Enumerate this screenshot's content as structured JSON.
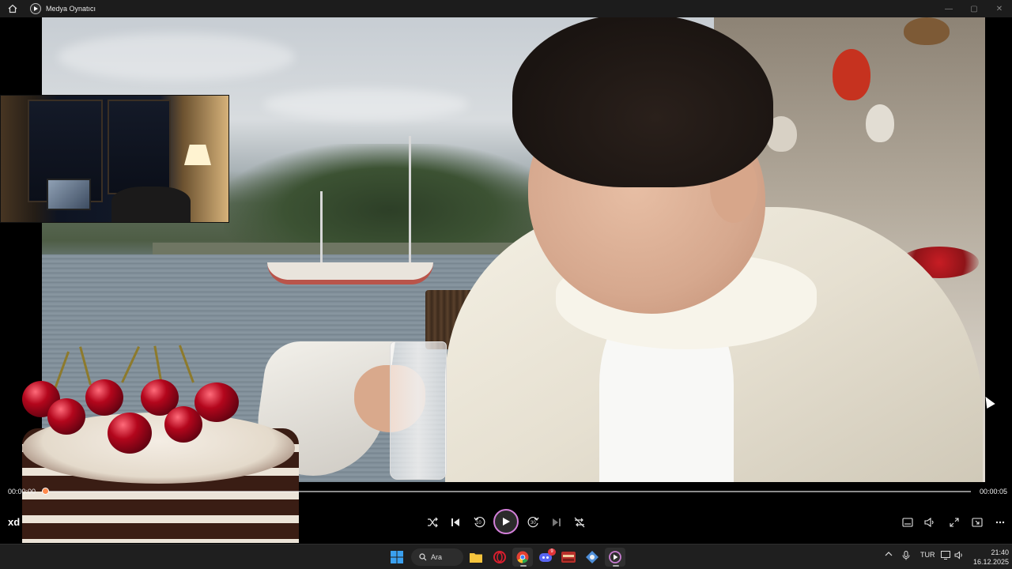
{
  "window": {
    "title": "Medya Oynatıcı",
    "home_icon": "home-icon",
    "app_icon": "media-player-icon",
    "controls": [
      "minimize-icon",
      "maximize-icon",
      "close-icon"
    ]
  },
  "player": {
    "current_time": "00:00:00",
    "total_time": "00:00:05",
    "progress_fraction": 0.0,
    "subtitle_label": "xd",
    "skip_back_seconds": "10",
    "skip_forward_seconds": "30",
    "controls": {
      "shuffle": "shuffle-icon",
      "previous": "previous-icon",
      "skip_back": "rewind-10-icon",
      "play": "play-icon",
      "skip_forward": "forward-30-icon",
      "next": "next-icon",
      "repeat_off": "repeat-off-icon",
      "captions": "captions-icon",
      "volume": "volume-icon",
      "fullscreen": "fullscreen-icon",
      "mini_player": "mini-player-icon",
      "more": "more-icon"
    },
    "accent_color": "#d27fd8",
    "seek_color": "#ff8a4c"
  },
  "taskbar": {
    "search_label": "Ara",
    "apps": [
      {
        "name": "start",
        "icon": "windows-icon"
      },
      {
        "name": "file-explorer",
        "icon": "folder-icon"
      },
      {
        "name": "opera",
        "icon": "opera-icon"
      },
      {
        "name": "chrome",
        "icon": "chrome-icon"
      },
      {
        "name": "discord",
        "icon": "discord-icon",
        "badge": "9"
      },
      {
        "name": "game",
        "icon": "game-icon"
      },
      {
        "name": "app",
        "icon": "app-icon"
      },
      {
        "name": "media-player",
        "icon": "media-player-icon"
      }
    ],
    "tray": {
      "language": "TUR",
      "time": "21:40",
      "date": "16.12.2025"
    }
  }
}
